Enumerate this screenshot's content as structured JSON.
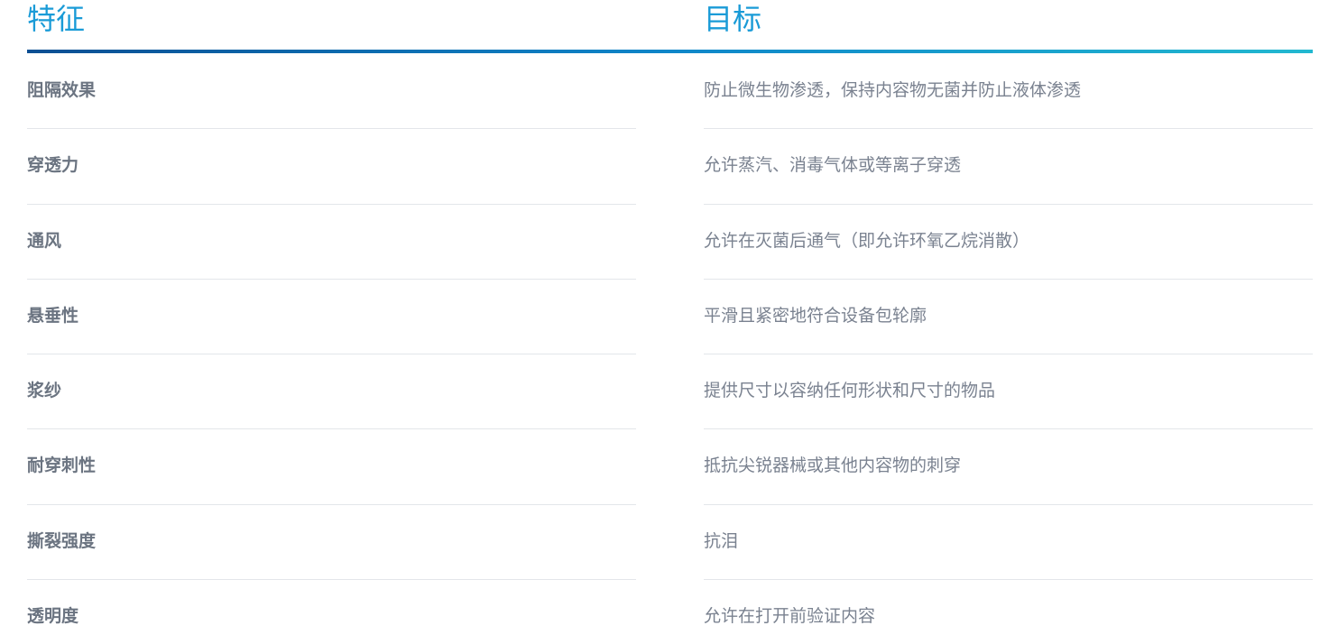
{
  "header": {
    "feature_label": "特征",
    "goal_label": "目标"
  },
  "rows": [
    {
      "feature": "阻隔效果",
      "goal": "防止微生物渗透，保持内容物无菌并防止液体渗透"
    },
    {
      "feature": "穿透力",
      "goal": "允许蒸汽、消毒气体或等离子穿透"
    },
    {
      "feature": "通风",
      "goal": "允许在灭菌后通气（即允许环氧乙烷消散）"
    },
    {
      "feature": "悬垂性",
      "goal": "平滑且紧密地符合设备包轮廓"
    },
    {
      "feature": "浆纱",
      "goal": "提供尺寸以容纳任何形状和尺寸的物品"
    },
    {
      "feature": "耐穿刺性",
      "goal": "抵抗尖锐器械或其他内容物的刺穿"
    },
    {
      "feature": "撕裂强度",
      "goal": "抗泪"
    },
    {
      "feature": "透明度",
      "goal": "允许在打开前验证内容"
    }
  ],
  "colors": {
    "title": "#1a9bd7",
    "rule_start": "#0b4f93",
    "rule_end": "#22b8d0",
    "feature_text": "#6b7481",
    "goal_text": "#7a8290",
    "divider": "#e3e6ea"
  }
}
